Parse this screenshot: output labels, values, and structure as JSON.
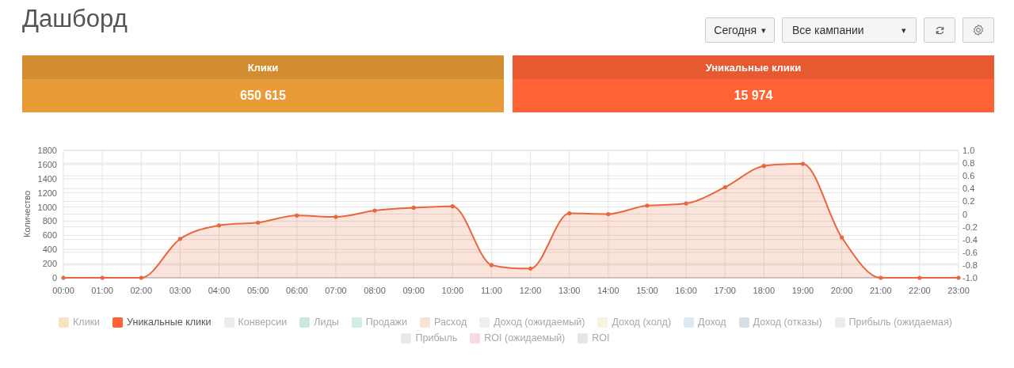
{
  "header": {
    "title": "Дашборд",
    "period": {
      "label": "Сегодня",
      "caret": "▾"
    },
    "campaign": {
      "label": "Все кампании",
      "caret": "▾"
    }
  },
  "tiles": [
    {
      "label": "Клики",
      "value": "650 615",
      "color": "#e89b36"
    },
    {
      "label": "Уникальные клики",
      "value": "15 974",
      "color": "#fe6235"
    }
  ],
  "chart": {
    "chart_data": {
      "type": "area",
      "ylabel": "Количество",
      "categories": [
        "00:00",
        "01:00",
        "02:00",
        "03:00",
        "04:00",
        "05:00",
        "06:00",
        "07:00",
        "08:00",
        "09:00",
        "10:00",
        "11:00",
        "12:00",
        "13:00",
        "14:00",
        "15:00",
        "16:00",
        "17:00",
        "18:00",
        "19:00",
        "20:00",
        "21:00",
        "22:00",
        "23:00"
      ],
      "grid": true,
      "series": [
        {
          "color": "#e8673c",
          "values": [
            0,
            0,
            0,
            550,
            740,
            780,
            880,
            860,
            950,
            990,
            1010,
            180,
            130,
            910,
            900,
            1020,
            1050,
            1280,
            1580,
            1610,
            570,
            0,
            0,
            0
          ]
        }
      ],
      "ylim": [
        0,
        1800
      ],
      "yticks": [
        0,
        200,
        400,
        600,
        800,
        1000,
        1200,
        1400,
        1600,
        1800
      ]
    },
    "secondary_ticks": [
      "1.0",
      "0.8",
      "0.6",
      "0.4",
      "0.2",
      "0",
      "-0.2",
      "-0.4",
      "-0.6",
      "-0.8",
      "-1.0"
    ]
  },
  "legend": [
    {
      "label": "Клики",
      "hidden": true,
      "color": "#f7e3c4"
    },
    {
      "label": "Уникальные клики",
      "hidden": false,
      "color": "#fe6235"
    },
    {
      "label": "Конверсии",
      "hidden": true,
      "color": "#efebea"
    },
    {
      "label": "Лиды",
      "hidden": true,
      "color": "#c9eadb"
    },
    {
      "label": "Продажи",
      "hidden": true,
      "color": "#d0efe2"
    },
    {
      "label": "Расход",
      "hidden": true,
      "color": "#f8e2d3"
    },
    {
      "label": "Доход (ожидаемый)",
      "hidden": true,
      "color": "#eeeeee"
    },
    {
      "label": "Доход (холд)",
      "hidden": true,
      "color": "#f7f3dc"
    },
    {
      "label": "Доход",
      "hidden": true,
      "color": "#dbe9f2"
    },
    {
      "label": "Доход (отказы)",
      "hidden": true,
      "color": "#d4dfe8"
    },
    {
      "label": "Прибыль (ожидаемая)",
      "hidden": true,
      "color": "#ececec"
    },
    {
      "label": "Прибыль",
      "hidden": true,
      "color": "#e9e9e9"
    },
    {
      "label": "ROI (ожидаемый)",
      "hidden": true,
      "color": "#f6dbe3"
    },
    {
      "label": "ROI",
      "hidden": true,
      "color": "#e6e6e6"
    }
  ]
}
